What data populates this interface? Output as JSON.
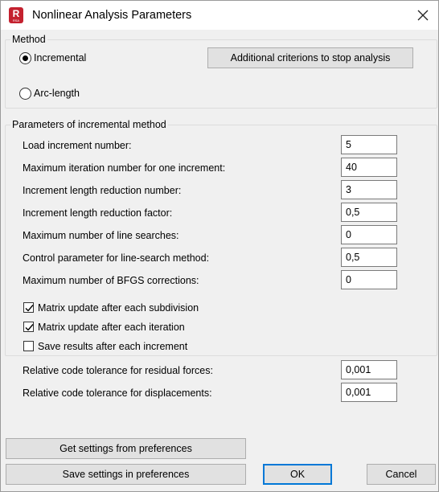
{
  "window": {
    "title": "Nonlinear Analysis Parameters",
    "app_icon_letter": "R",
    "app_icon_sub": "RSA"
  },
  "method": {
    "group_label": "Method",
    "incremental_label": "Incremental",
    "arc_length_label": "Arc-length",
    "selected": "Incremental",
    "criteria_button": "Additional criterions to stop analysis"
  },
  "params": {
    "group_label": "Parameters of incremental method",
    "rows": [
      {
        "label": "Load increment number:",
        "value": "5"
      },
      {
        "label": "Maximum iteration number for one increment:",
        "value": "40"
      },
      {
        "label": "Increment length reduction number:",
        "value": "3"
      },
      {
        "label": "Increment length reduction factor:",
        "value": "0,5"
      },
      {
        "label": "Maximum number of line searches:",
        "value": "0"
      },
      {
        "label": "Control parameter for line-search method:",
        "value": "0,5"
      },
      {
        "label": "Maximum number of BFGS corrections:",
        "value": "0"
      }
    ],
    "checkboxes": [
      {
        "label": "Matrix update after each subdivision",
        "checked": true
      },
      {
        "label": "Matrix update after each iteration",
        "checked": true
      },
      {
        "label": "Save results after each increment",
        "checked": false
      }
    ]
  },
  "tolerances": [
    {
      "label": "Relative code tolerance for residual forces:",
      "value": "0,001"
    },
    {
      "label": "Relative code tolerance for displacements:",
      "value": "0,001"
    }
  ],
  "buttons": {
    "get_settings": "Get settings from preferences",
    "save_settings": "Save settings in preferences",
    "ok": "OK",
    "cancel": "Cancel"
  }
}
